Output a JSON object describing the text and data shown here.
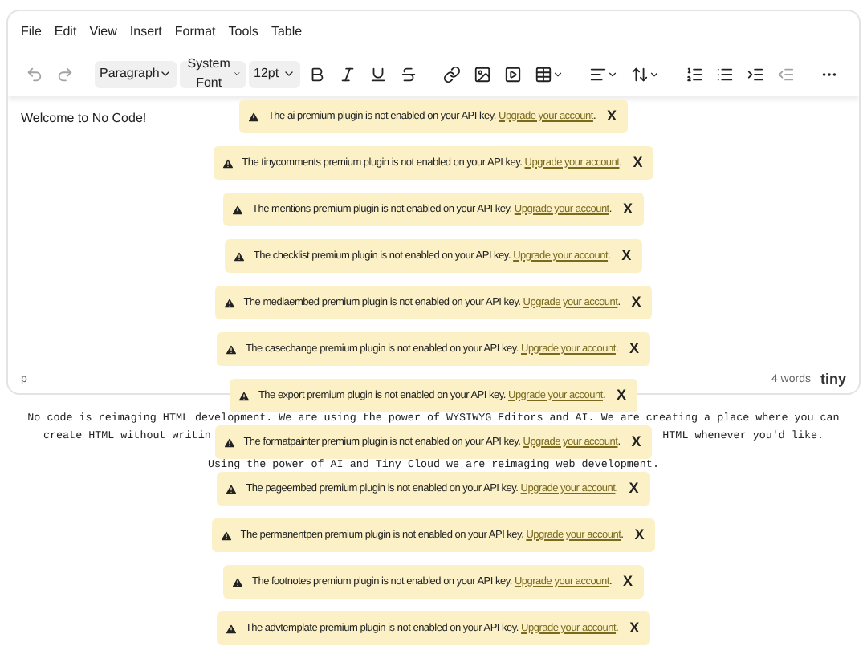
{
  "menubar": [
    "File",
    "Edit",
    "View",
    "Insert",
    "Format",
    "Tools",
    "Table"
  ],
  "toolbar": [
    {
      "kind": "undo",
      "disabled": true
    },
    {
      "kind": "redo",
      "disabled": true
    },
    {
      "kind": "select",
      "label": "Paragraph"
    },
    {
      "kind": "select",
      "label": "System Font"
    },
    {
      "kind": "select",
      "label": "12pt"
    },
    {
      "kind": "bold",
      "disabled": false
    },
    {
      "kind": "italic",
      "disabled": false
    },
    {
      "kind": "underline",
      "disabled": false
    },
    {
      "kind": "strike",
      "disabled": false
    },
    {
      "kind": "link",
      "disabled": false
    },
    {
      "kind": "image",
      "disabled": false
    },
    {
      "kind": "media",
      "disabled": false
    },
    {
      "kind": "table",
      "disabled": false
    },
    {
      "kind": "align",
      "disabled": false
    },
    {
      "kind": "lineheight",
      "disabled": false
    },
    {
      "kind": "numlist",
      "disabled": false
    },
    {
      "kind": "bullist",
      "disabled": false
    },
    {
      "kind": "indent",
      "disabled": false
    },
    {
      "kind": "outdent",
      "disabled": true
    },
    {
      "kind": "more",
      "disabled": false
    }
  ],
  "content": "Welcome to No Code!",
  "status_bar": {
    "path": "p",
    "word_count": "4 words",
    "logo": "tiny"
  },
  "body_lines": [
    "No code is reimaging HTML development. We are using the power of WYSIWYG Editors and AI. We are creating a place where you can",
    "create HTML without writin",
    "HTML whenever you'd like.",
    "Using the power of AI and Tiny Cloud we are reimaging web development."
  ],
  "notifications": [
    {
      "text": "The ai premium plugin is not enabled on your API key. ",
      "link": "Upgrade your account",
      "end": ".",
      "close": "X"
    },
    {
      "text": "The tinycomments premium plugin is not enabled on your API key. ",
      "link": "Upgrade your account",
      "end": ".",
      "close": "X"
    },
    {
      "text": "The mentions premium plugin is not enabled on your API key. ",
      "link": "Upgrade your account",
      "end": ".",
      "close": "X"
    },
    {
      "text": "The checklist premium plugin is not enabled on your API key. ",
      "link": "Upgrade your account",
      "end": ".",
      "close": "X"
    },
    {
      "text": "The mediaembed premium plugin is not enabled on your API key. ",
      "link": "Upgrade your account",
      "end": ".",
      "close": "X"
    },
    {
      "text": "The casechange premium plugin is not enabled on your API key. ",
      "link": "Upgrade your account",
      "end": ".",
      "close": "X"
    },
    {
      "text": "The export premium plugin is not enabled on your API key. ",
      "link": "Upgrade your account",
      "end": ".",
      "close": "X"
    },
    {
      "text": "The formatpainter premium plugin is not enabled on your API key. ",
      "link": "Upgrade your account",
      "end": ".",
      "close": "X"
    },
    {
      "text": "The pageembed premium plugin is not enabled on your API key. ",
      "link": "Upgrade your account",
      "end": ".",
      "close": "X"
    },
    {
      "text": "The permanentpen premium plugin is not enabled on your API key. ",
      "link": "Upgrade your account",
      "end": ".",
      "close": "X"
    },
    {
      "text": "The footnotes premium plugin is not enabled on your API key. ",
      "link": "Upgrade your account",
      "end": ".",
      "close": "X"
    },
    {
      "text": "The advtemplate premium plugin is not enabled on your API key. ",
      "link": "Upgrade your account",
      "end": ".",
      "close": "X"
    }
  ]
}
